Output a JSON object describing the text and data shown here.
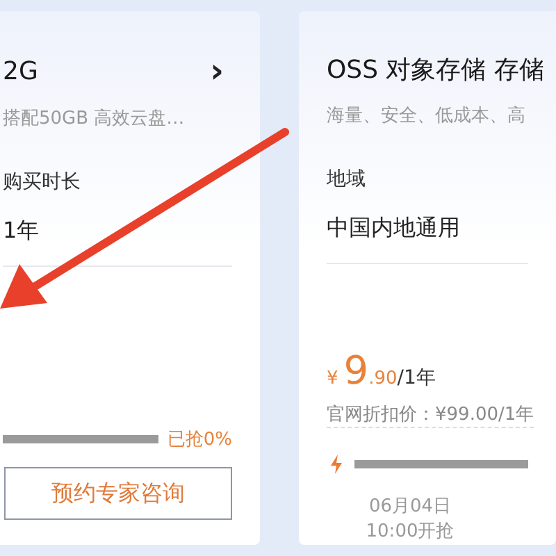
{
  "cards": [
    {
      "title": "2G",
      "chevron": "›",
      "subtitle": "搭配50GB 高效云盘…",
      "option_label": "购买时长",
      "option_value": "1年",
      "kind": "offer",
      "progress_reading": "已抢0%",
      "button": "预约专家咨询"
    },
    {
      "title": "OSS 对象存储 存储",
      "subtitle": "海量、安全、低成本、高",
      "option_label": "地域",
      "option_value": "中国内地通用",
      "price": {
        "currency": "¥",
        "integer": "9",
        "decimal": ".90",
        "unit": "/1年",
        "original": "官网折扣价：¥99.00/1年"
      },
      "kind": "presale",
      "start_date": "06月04日",
      "start_time": "10:00开抢"
    }
  ]
}
